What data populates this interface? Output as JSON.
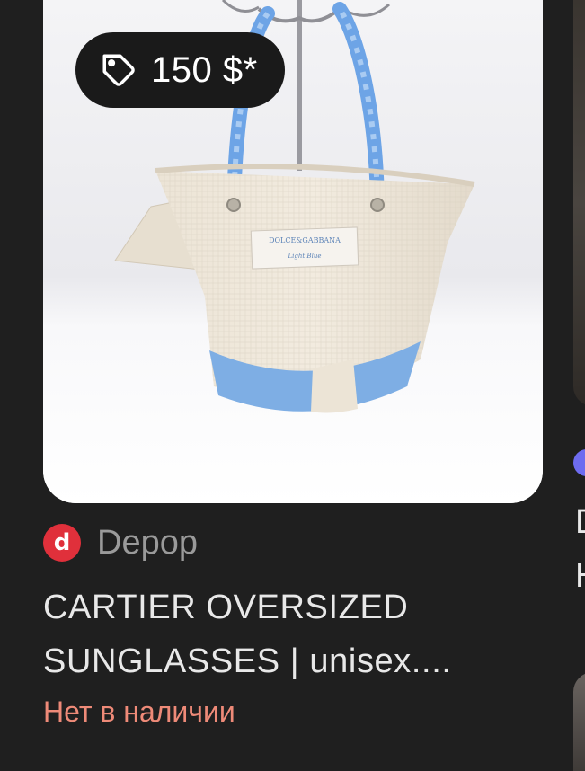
{
  "product": {
    "price": "150 $*",
    "source": "Depop",
    "source_logo_letter": "d",
    "title_line1": "CARTIER OVERSIZED",
    "title_line2": "SUNGLASSES | unisex....",
    "availability": "Нет в наличии"
  },
  "image_label": {
    "brand": "DOLCE&GABBANA",
    "sub": "Light Blue"
  },
  "next_card": {
    "title_line1": "D",
    "title_line2": "H"
  },
  "colors": {
    "background": "#1f1f1f",
    "price_badge": "#1a1a1a",
    "depop_red": "#e0303b",
    "availability": "#ee8a78",
    "next_source_dot": "#6e6cf0"
  },
  "icons": {
    "price_tag": "price-tag-icon"
  }
}
